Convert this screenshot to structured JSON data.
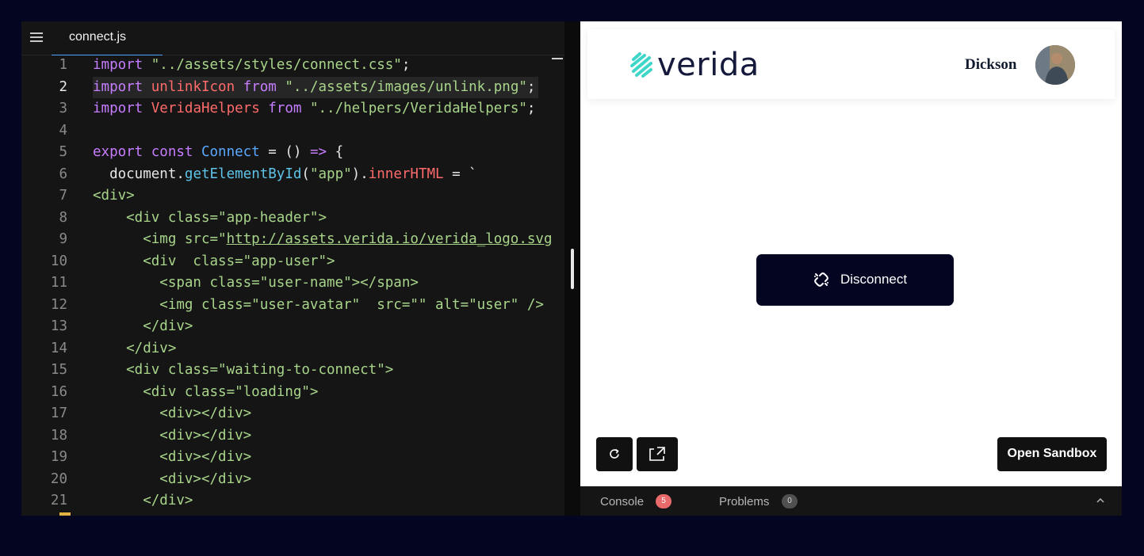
{
  "editor": {
    "tab_label": "connect.js",
    "lines": [
      {
        "n": "1",
        "tokens": [
          [
            "kw",
            "import "
          ],
          [
            "str",
            "\"../assets/styles/connect.css\""
          ],
          [
            "pl",
            ";"
          ]
        ]
      },
      {
        "n": "2",
        "active": true,
        "tokens": [
          [
            "kw",
            "import "
          ],
          [
            "id",
            "unlinkIcon "
          ],
          [
            "kw",
            "from "
          ],
          [
            "str",
            "\"../assets/images/unlink.png\""
          ],
          [
            "pl",
            ";"
          ]
        ]
      },
      {
        "n": "3",
        "tokens": [
          [
            "kw",
            "import "
          ],
          [
            "id",
            "VeridaHelpers "
          ],
          [
            "kw",
            "from "
          ],
          [
            "str",
            "\"../helpers/VeridaHelpers\""
          ],
          [
            "pl",
            ";"
          ]
        ]
      },
      {
        "n": "4",
        "tokens": []
      },
      {
        "n": "5",
        "tokens": [
          [
            "kw",
            "export const "
          ],
          [
            "cls",
            "Connect"
          ],
          [
            "pl",
            " = () "
          ],
          [
            "kw",
            "=>"
          ],
          [
            "pl",
            " {"
          ]
        ]
      },
      {
        "n": "6",
        "tokens": [
          [
            "pl",
            "  document."
          ],
          [
            "fn",
            "getElementById"
          ],
          [
            "pl",
            "("
          ],
          [
            "str",
            "\"app\""
          ],
          [
            "pl",
            ")."
          ],
          [
            "id",
            "innerHTML"
          ],
          [
            "pl",
            " = `"
          ]
        ]
      },
      {
        "n": "7",
        "tokens": [
          [
            "tag",
            "<div>"
          ]
        ]
      },
      {
        "n": "8",
        "tokens": [
          [
            "tag",
            "    <div class=\"app-header\">"
          ]
        ]
      },
      {
        "n": "9",
        "tokens": [
          [
            "tag",
            "      <img src=\""
          ],
          [
            "tag url",
            "http://assets.verida.io/verida_logo.svg"
          ]
        ]
      },
      {
        "n": "10",
        "tokens": [
          [
            "tag",
            "      <div  class=\"app-user\">"
          ]
        ]
      },
      {
        "n": "11",
        "tokens": [
          [
            "tag",
            "        <span class=\"user-name\"></span>"
          ]
        ]
      },
      {
        "n": "12",
        "tokens": [
          [
            "tag",
            "        <img class=\"user-avatar\"  src=\"\" alt=\"user\" />"
          ]
        ]
      },
      {
        "n": "13",
        "tokens": [
          [
            "tag",
            "      </div>"
          ]
        ]
      },
      {
        "n": "14",
        "tokens": [
          [
            "tag",
            "    </div>"
          ]
        ]
      },
      {
        "n": "15",
        "tokens": [
          [
            "tag",
            "    <div class=\"waiting-to-connect\">"
          ]
        ]
      },
      {
        "n": "16",
        "tokens": [
          [
            "tag",
            "      <div class=\"loading\">"
          ]
        ]
      },
      {
        "n": "17",
        "tokens": [
          [
            "tag",
            "        <div></div>"
          ]
        ]
      },
      {
        "n": "18",
        "tokens": [
          [
            "tag",
            "        <div></div>"
          ]
        ]
      },
      {
        "n": "19",
        "tokens": [
          [
            "tag",
            "        <div></div>"
          ]
        ]
      },
      {
        "n": "20",
        "tokens": [
          [
            "tag",
            "        <div></div>"
          ]
        ]
      },
      {
        "n": "21",
        "tokens": [
          [
            "tag",
            "      </div>"
          ]
        ]
      }
    ]
  },
  "preview": {
    "logo_text": "verida",
    "user_name": "Dickson",
    "disconnect_label": "Disconnect",
    "open_sandbox_label": "Open Sandbox",
    "reload_icon": "reload-icon",
    "open_new_window_icon": "open-new-window-icon"
  },
  "bottom_panel": {
    "console_label": "Console",
    "console_count": "5",
    "problems_label": "Problems",
    "problems_count": "0"
  },
  "colors": {
    "page_background": "#040521",
    "editor_background": "#151515",
    "keyword": "#c77dff",
    "identifier": "#ff6b6b",
    "string": "#a8d58a",
    "function": "#5ec4e8",
    "class_name": "#5aa9ff",
    "button_dark": "#030521",
    "logo_teal": "#3ed6c8",
    "logo_navy": "#15193b",
    "console_badge": "#e86a6a"
  }
}
